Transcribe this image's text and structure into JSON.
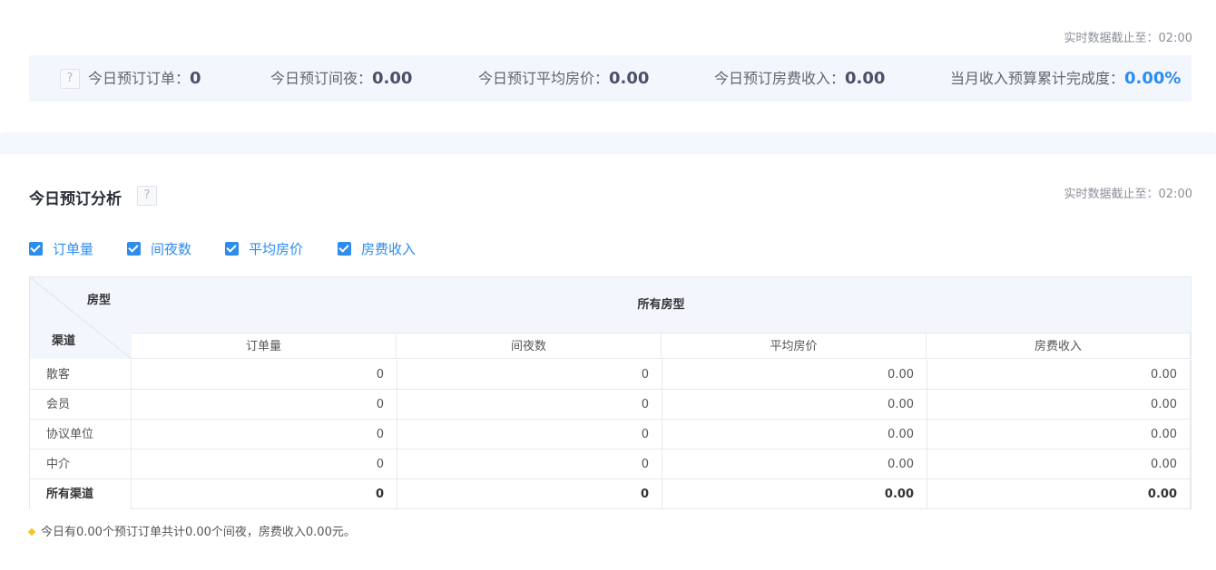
{
  "realtime_top": "实时数据截止至：02:00",
  "help_glyph": "?",
  "summary": [
    {
      "label": "今日预订订单：",
      "value": "0"
    },
    {
      "label": "今日预订间夜：",
      "value": "0.00"
    },
    {
      "label": "今日预订平均房价：",
      "value": "0.00"
    },
    {
      "label": "今日预订房费收入：",
      "value": "0.00"
    },
    {
      "label": "当月收入预算累计完成度：",
      "value": "0.00%"
    }
  ],
  "analysis": {
    "title": "今日预订分析",
    "realtime": "实时数据截止至：02:00",
    "checkboxes": [
      {
        "label": "订单量",
        "checked": true
      },
      {
        "label": "间夜数",
        "checked": true
      },
      {
        "label": "平均房价",
        "checked": true
      },
      {
        "label": "房费收入",
        "checked": true
      }
    ]
  },
  "table": {
    "corner_room": "房型",
    "corner_channel": "渠道",
    "group_title": "所有房型",
    "columns": [
      "订单量",
      "间夜数",
      "平均房价",
      "房费收入"
    ],
    "rows": [
      {
        "name": "散客",
        "values": [
          "0",
          "0",
          "0.00",
          "0.00"
        ]
      },
      {
        "name": "会员",
        "values": [
          "0",
          "0",
          "0.00",
          "0.00"
        ]
      },
      {
        "name": "协议单位",
        "values": [
          "0",
          "0",
          "0.00",
          "0.00"
        ]
      },
      {
        "name": "中介",
        "values": [
          "0",
          "0",
          "0.00",
          "0.00"
        ]
      },
      {
        "name": "所有渠道",
        "values": [
          "0",
          "0",
          "0.00",
          "0.00"
        ]
      }
    ]
  },
  "note": "今日有0.00个预订订单共计0.00个间夜，房费收入0.00元。",
  "colors": {
    "accent": "#2d8cf0",
    "summary_bg": "#f3f7fd",
    "note_dot": "#f5c518"
  }
}
